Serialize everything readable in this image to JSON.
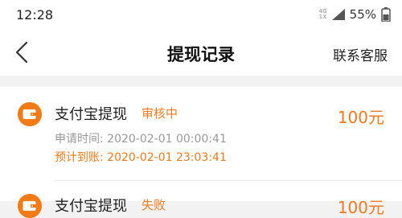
{
  "status_bar": {
    "time": "12:28",
    "net_top": "4G",
    "net_bottom": "1X",
    "battery": "55%"
  },
  "header": {
    "title": "提现记录",
    "contact_label": "联系客服"
  },
  "records": [
    {
      "title": "支付宝提现",
      "status": "审核中",
      "amount": "100元",
      "apply_label": "申请时间:",
      "apply_time": "2020-02-01 00:00:41",
      "arrival_label": "预计到账:",
      "arrival_time": "2020-02-01 23:03:41"
    },
    {
      "title": "支付宝提现",
      "status": "失败",
      "amount": "100元"
    }
  ],
  "colors": {
    "accent": "#f07b1e",
    "icon_bg": "#f37a14",
    "secondary_text": "#999999"
  }
}
